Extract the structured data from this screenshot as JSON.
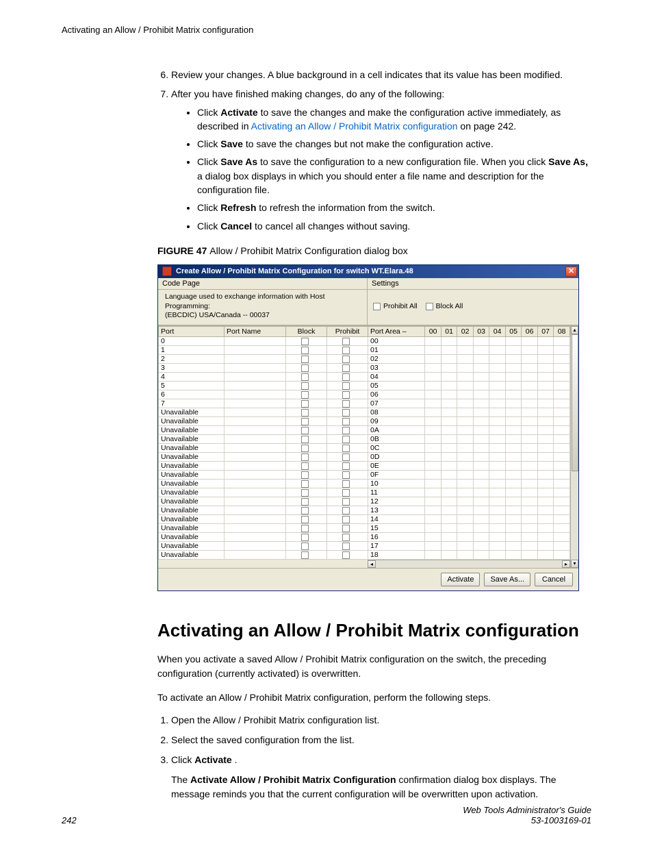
{
  "running_head": "Activating an Allow / Prohibit Matrix configuration",
  "list": {
    "item6": "Review your changes. A blue background in a cell indicates that its value has been modified.",
    "item7_lead": "After you have finished making changes, do any of the following:",
    "b1a": "Click ",
    "b1b": "Activate",
    "b1c": " to save the changes and make the configuration active immediately, as described in ",
    "b1_link": "Activating an Allow / Prohibit Matrix configuration",
    "b1d": " on page 242.",
    "b2a": "Click ",
    "b2b": "Save",
    "b2c": " to save the changes but not make the configuration active.",
    "b3a": "Click ",
    "b3b": "Save As",
    "b3c": " to save the configuration to a new configuration file. When you click ",
    "b3d": "Save As,",
    "b3e": " a dialog box displays in which you should enter a file name and description for the configuration file.",
    "b4a": "Click ",
    "b4b": "Refresh",
    "b4c": " to refresh the information from the switch.",
    "b5a": "Click ",
    "b5b": "Cancel",
    "b5c": " to cancel all changes without saving."
  },
  "figure": {
    "label": "FIGURE 47 ",
    "caption": "Allow / Prohibit Matrix Configuration dialog box"
  },
  "dialog": {
    "title": "Create Allow / Prohibit Matrix Configuration for switch WT.Elara.48",
    "code_page_label": "Code Page",
    "settings_label": "Settings",
    "lang_text1": "Language used to exchange information with Host Programming:",
    "lang_text2": "(EBCDIC) USA/Canada -- 00037",
    "prohibit_all": "Prohibit All",
    "block_all": "Block All",
    "cols": {
      "port": "Port",
      "port_name": "Port Name",
      "block": "Block",
      "prohibit": "Prohibit",
      "port_area": "Port Area  –"
    },
    "area_cols": [
      "00",
      "01",
      "02",
      "03",
      "04",
      "05",
      "06",
      "07",
      "08"
    ],
    "rows": [
      {
        "port": "0",
        "area": "00"
      },
      {
        "port": "1",
        "area": "01"
      },
      {
        "port": "2",
        "area": "02"
      },
      {
        "port": "3",
        "area": "03"
      },
      {
        "port": "4",
        "area": "04"
      },
      {
        "port": "5",
        "area": "05"
      },
      {
        "port": "6",
        "area": "06"
      },
      {
        "port": "7",
        "area": "07"
      },
      {
        "port": "Unavailable",
        "area": "08"
      },
      {
        "port": "Unavailable",
        "area": "09"
      },
      {
        "port": "Unavailable",
        "area": "0A"
      },
      {
        "port": "Unavailable",
        "area": "0B"
      },
      {
        "port": "Unavailable",
        "area": "0C"
      },
      {
        "port": "Unavailable",
        "area": "0D"
      },
      {
        "port": "Unavailable",
        "area": "0E"
      },
      {
        "port": "Unavailable",
        "area": "0F"
      },
      {
        "port": "Unavailable",
        "area": "10"
      },
      {
        "port": "Unavailable",
        "area": "11"
      },
      {
        "port": "Unavailable",
        "area": "12"
      },
      {
        "port": "Unavailable",
        "area": "13"
      },
      {
        "port": "Unavailable",
        "area": "14"
      },
      {
        "port": "Unavailable",
        "area": "15"
      },
      {
        "port": "Unavailable",
        "area": "16"
      },
      {
        "port": "Unavailable",
        "area": "17"
      },
      {
        "port": "Unavailable",
        "area": "18"
      }
    ],
    "buttons": {
      "activate": "Activate",
      "saveas": "Save As...",
      "cancel": "Cancel"
    }
  },
  "section": {
    "title": "Activating an Allow / Prohibit Matrix configuration",
    "p1": "When you activate a saved Allow / Prohibit Matrix configuration on the switch, the preceding configuration (currently activated) is overwritten.",
    "p2": "To activate an Allow / Prohibit Matrix configuration, perform the following steps.",
    "s1": "Open the Allow / Prohibit Matrix configuration list.",
    "s2": "Select the saved configuration from the list.",
    "s3a": "Click ",
    "s3b": "Activate",
    "s3c": " .",
    "s3_p_a": "The ",
    "s3_p_b": "Activate Allow / Prohibit Matrix Configuration",
    "s3_p_c": " confirmation dialog box displays. The message reminds you that the current configuration will be overwritten upon activation."
  },
  "footer": {
    "page": "242",
    "line1": "Web Tools Administrator's Guide",
    "line2": "53-1003169-01"
  }
}
